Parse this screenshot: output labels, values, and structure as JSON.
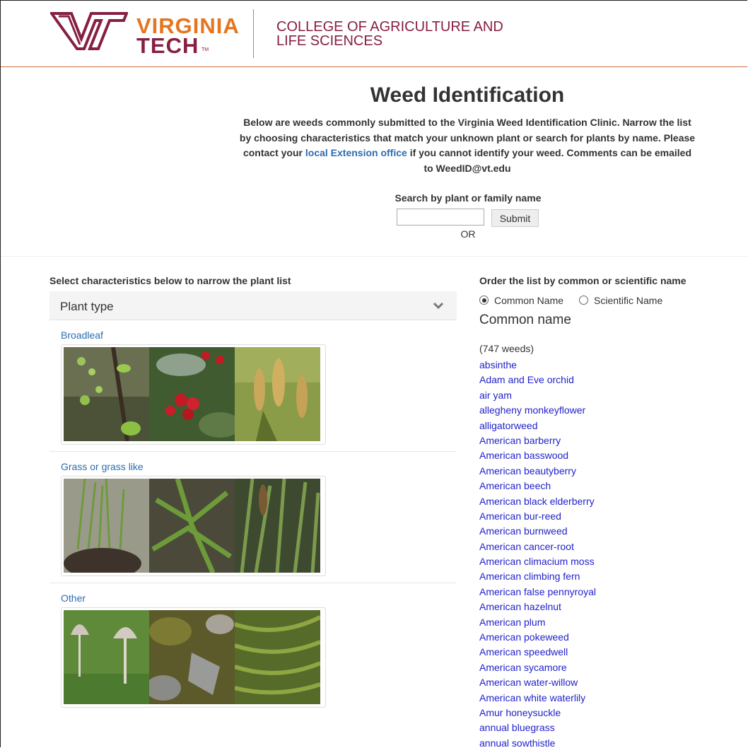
{
  "header": {
    "logo_word1": "VIRGINIA",
    "logo_word2": "TECH",
    "logo_tm": "TM",
    "college_line1": "COLLEGE OF AGRICULTURE AND",
    "college_line2": "LIFE SCIENCES"
  },
  "intro": {
    "title": "Weed Identification",
    "text_before": "Below are weeds commonly submitted to the Virginia Weed Identification Clinic. Narrow the list by choosing characteristics that match your unknown plant or search for plants by name. Please contact your",
    "link": "local Extension office",
    "text_after": "if you cannot identify your weed. Comments can be emailed to WeedID@vt.edu"
  },
  "search": {
    "label": "Search by plant or family name",
    "value": "",
    "placeholder": "",
    "submit_label": "Submit",
    "or_label": "OR"
  },
  "filters": {
    "heading": "Select characteristics below to narrow the plant list",
    "accordion_label": "Plant type",
    "categories": [
      {
        "label": "Broadleaf"
      },
      {
        "label": "Grass or grass like"
      },
      {
        "label": "Other"
      }
    ]
  },
  "ordering": {
    "heading": "Order the list by common or scientific name",
    "options": [
      {
        "label": "Common Name",
        "selected": true
      },
      {
        "label": "Scientific Name",
        "selected": false
      }
    ],
    "list_heading": "Common name",
    "count": "(747 weeds)"
  },
  "weeds": [
    "absinthe",
    "Adam and Eve orchid",
    "air yam",
    "allegheny monkeyflower",
    "alligatorweed",
    "American barberry",
    "American basswood",
    "American beautyberry",
    "American beech",
    "American black elderberry",
    "American bur-reed",
    "American burnweed",
    "American cancer-root",
    "American climacium moss",
    "American climbing fern",
    "American false pennyroyal",
    "American hazelnut",
    "American plum",
    "American pokeweed",
    "American speedwell",
    "American sycamore",
    "American water-willow",
    "American white waterlily",
    "Amur honeysuckle",
    "annual bluegrass",
    "annual sowthistle"
  ],
  "colors": {
    "vt_orange": "#e5751f",
    "vt_maroon": "#861f41",
    "link_blue": "#2a6db0",
    "list_link": "#2222cc"
  }
}
